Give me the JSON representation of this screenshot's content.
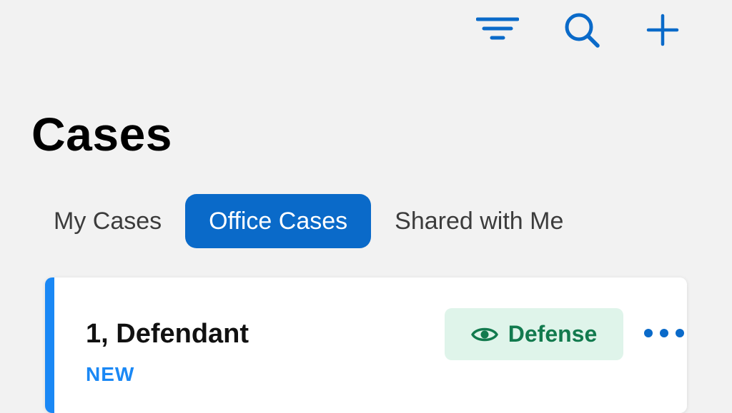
{
  "toolbar": {
    "filter_icon": "filter-icon",
    "search_icon": "search-icon",
    "add_icon": "plus-icon",
    "icon_color": "#0a6ac9"
  },
  "page": {
    "title": "Cases"
  },
  "tabs": [
    {
      "label": "My Cases",
      "active": false
    },
    {
      "label": "Office Cases",
      "active": true
    },
    {
      "label": "Shared with Me",
      "active": false
    }
  ],
  "case_list": [
    {
      "name": "1, Defendant",
      "status": "NEW",
      "role": "Defense",
      "role_icon": "eye-icon",
      "more_icon": "more-horizontal-icon"
    }
  ],
  "colors": {
    "accent_blue": "#0a6ac9",
    "status_blue": "#1a88f5",
    "badge_bg": "#dff4ea",
    "badge_text": "#127a4e",
    "background": "#f2f2f2"
  }
}
